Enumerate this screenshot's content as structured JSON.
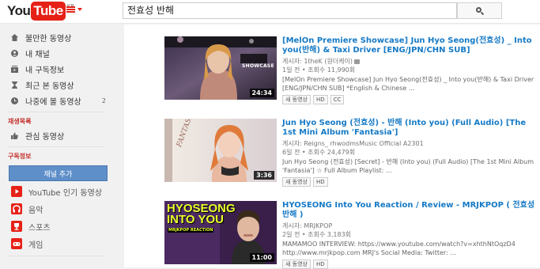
{
  "masthead": {
    "logo_you": "You",
    "logo_tube": "Tube",
    "logo_country": "KR",
    "search_value": "전효성 반해"
  },
  "guide": {
    "items": [
      {
        "label": "불만한 동영상",
        "icon": "home-icon"
      },
      {
        "label": "내 채널",
        "icon": "person-icon"
      },
      {
        "label": "내 구독정보",
        "icon": "subscriptions-icon"
      },
      {
        "label": "최근 본 동영상",
        "icon": "hourglass-icon"
      },
      {
        "label": "나중에 볼 동영상",
        "icon": "clock-icon",
        "count": "2"
      }
    ],
    "playlists_header": "재생목록",
    "playlist_items": [
      {
        "label": "관심 동영상",
        "icon": "thumbs-up-icon"
      }
    ],
    "subs_header": "구독정보",
    "subscribe_button": "채널 추가",
    "channels": [
      {
        "label": "YouTube 인기 동영상",
        "color": "#e62117"
      },
      {
        "label": "음악",
        "color": "#e62117"
      },
      {
        "label": "스포츠",
        "color": "#e62117"
      },
      {
        "label": "게임",
        "color": "#e62117"
      }
    ]
  },
  "results": [
    {
      "title": "[MelOn Premiere Showcase] Jun Hyo Seong(전효성) _ Into you(반해) & Taxi Driver [ENG/JPN/CHN SUB]",
      "channel": "게시자: 1theK (원더케이)",
      "stats": "1일 전 • 조회수 11,990회",
      "description": "[MelOn Premiere Showcase] Jun Hyo Seong(전효성) _ Into you(반해) & Taxi Driver [ENG/JPN/CHN SUB] *English & Chinese ...",
      "badges": [
        "새 동영상",
        "HD",
        "CC"
      ],
      "duration": "24:34",
      "thumb_overlay": "SHOWCASE"
    },
    {
      "title": "Jun Hyo Seong (전효성) - 반해 (Into you) (Full Audio) [The 1st Mini Album 'Fantasia']",
      "channel": "게시자: Reigns_ rhwodmsMusic Official A2301",
      "stats": "6일 전 • 조회수 24,479회",
      "description": "Jun Hyo Seong (전효성) [Secret] - 반해 (Into you) (Full Audio) [The 1st Mini Album 'Fantasia'] ☆ Full Album Playlist: ...",
      "badges": [
        "새 동영상",
        "HD"
      ],
      "duration": "3:36",
      "thumb_overlay": "FANTASIA"
    },
    {
      "title": "HYOSEONG Into You Reaction / Review - MRJKPOP ( 전효성 반해 )",
      "channel": "게시자: MRJKPOP",
      "stats": "2일 전 • 조회수 3,183회",
      "description": "MAMAMOO INTERVIEW: https://www.youtube.com/watch?v=xhthNtOqzD4 http://www.mrjkpop.com MRJ's Social Media: Twitter: ...",
      "badges": [
        "새 동영상",
        "HD"
      ],
      "duration": "11:00",
      "thumb_overlay": "HYOSEONG INTO YOU",
      "thumb_overlay_sub": "MRJKPOP REACTION"
    }
  ]
}
